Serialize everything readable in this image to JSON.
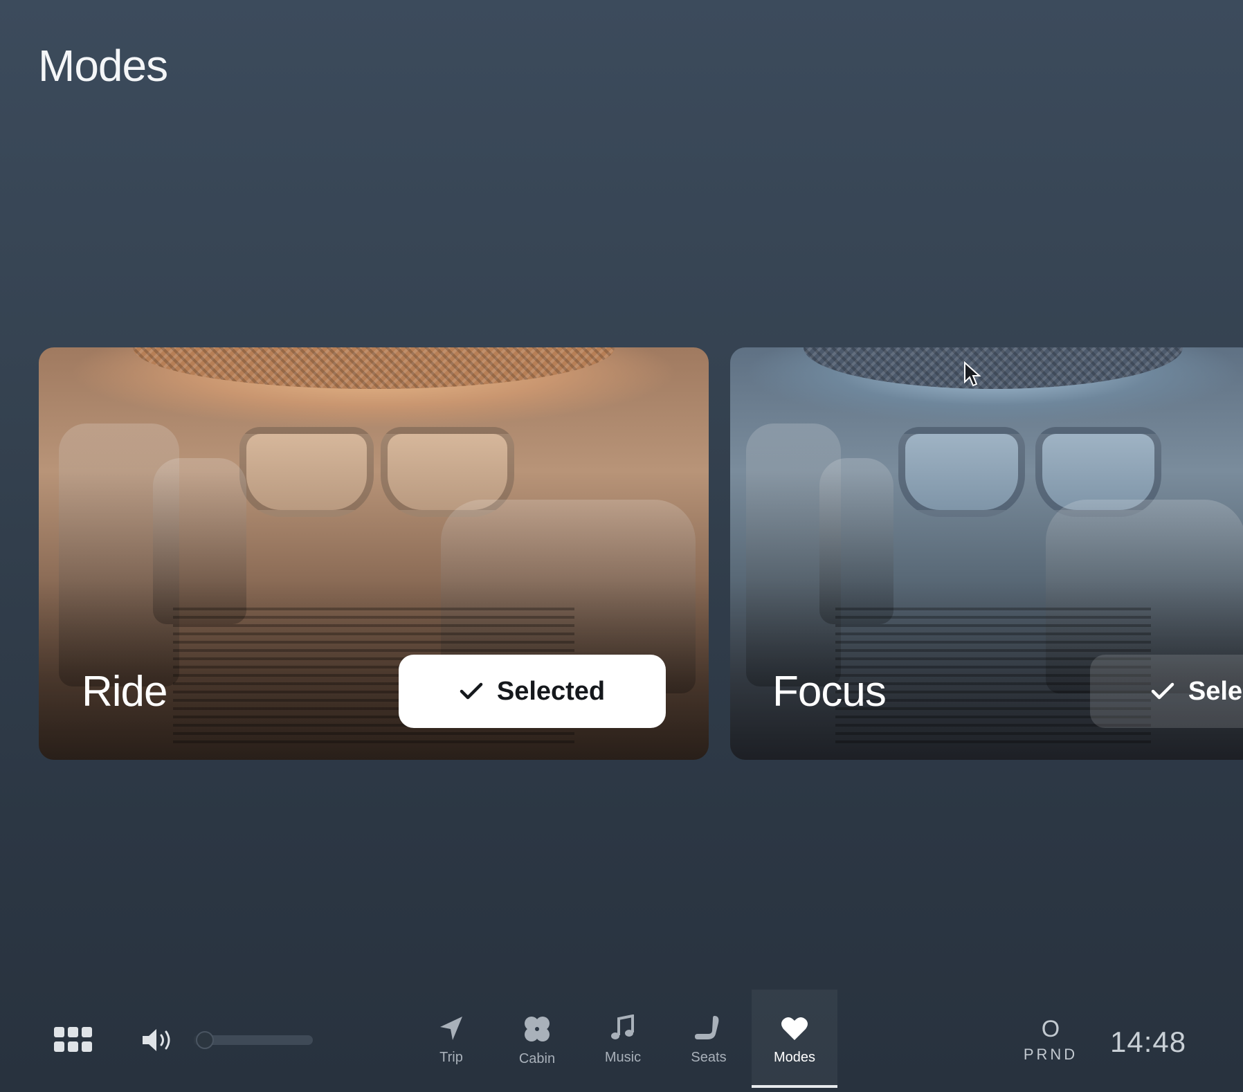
{
  "header": {
    "title": "Modes"
  },
  "modes": [
    {
      "label": "Ride",
      "button_label": "Selected",
      "selected": true
    },
    {
      "label": "Focus",
      "button_label": "Selected",
      "selected": false
    }
  ],
  "bottom_bar": {
    "volume_level": 0.05,
    "nav": [
      {
        "label": "Trip",
        "icon": "navigation-arrow-icon"
      },
      {
        "label": "Cabin",
        "icon": "fan-icon"
      },
      {
        "label": "Music",
        "icon": "music-note-icon"
      },
      {
        "label": "Seats",
        "icon": "seat-icon"
      },
      {
        "label": "Modes",
        "icon": "heart-icon",
        "active": true
      }
    ],
    "gear": {
      "current": "O",
      "label": "PRND"
    },
    "clock": "14:48"
  },
  "colors": {
    "background": "#34414f",
    "active_button": "#ffffff",
    "inactive_nav_text": "#a9b1ba"
  }
}
